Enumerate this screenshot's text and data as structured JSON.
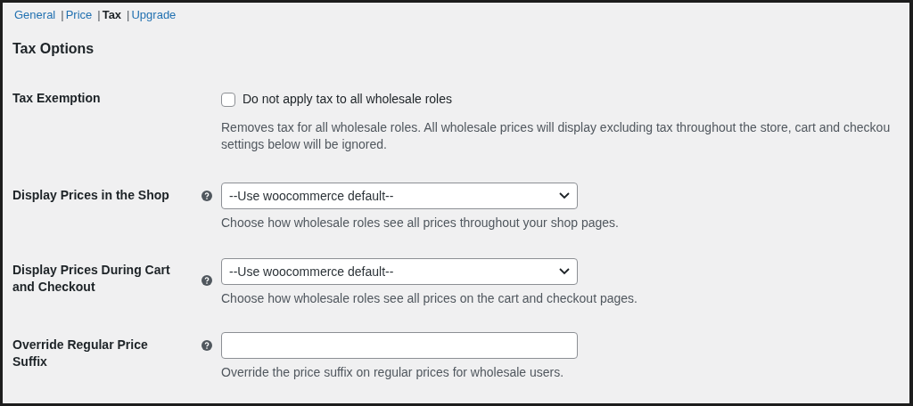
{
  "tabs": [
    {
      "label": "General",
      "selected": false
    },
    {
      "separator": "|",
      "label": "Price",
      "selected": false
    },
    {
      "separator": "|",
      "label": "Tax",
      "selected": true
    },
    {
      "separator": "|",
      "label": "Upgrade",
      "selected": false
    }
  ],
  "heading": "Tax Options",
  "settings": [
    {
      "kind": "checkbox",
      "label": "Tax Exemption",
      "help": false,
      "checked": false,
      "checkbox_label": "Do not apply tax to all wholesale roles",
      "description_lines": [
        "Removes tax for all wholesale roles. All wholesale prices will display excluding tax throughout the store, cart and checkou",
        "settings below will be ignored."
      ]
    },
    {
      "kind": "select",
      "label": "Display Prices in the Shop",
      "help": true,
      "value": "--Use woocommerce default--",
      "description_lines": [
        "Choose how wholesale roles see all prices throughout your shop pages."
      ]
    },
    {
      "kind": "select",
      "label": "Display Prices During Cart and Checkout",
      "help": true,
      "value": "--Use woocommerce default--",
      "description_lines": [
        "Choose how wholesale roles see all prices on the cart and checkout pages."
      ]
    },
    {
      "kind": "text",
      "label": "Override Regular Price Suffix",
      "help": true,
      "description_lines": [
        "Override the price suffix on regular prices for wholesale users."
      ]
    }
  ]
}
